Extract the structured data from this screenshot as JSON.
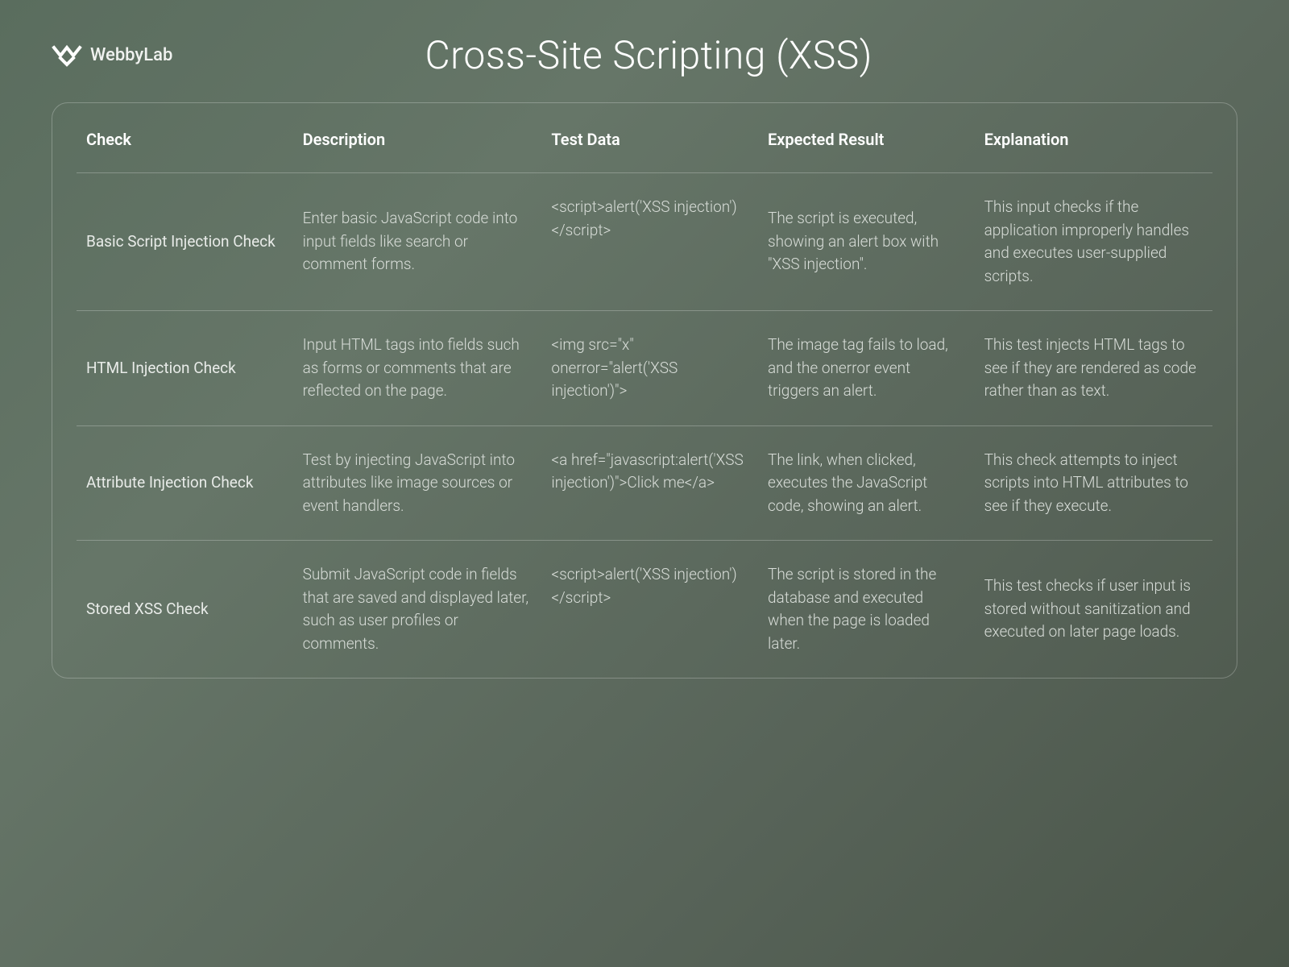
{
  "brand": "WebbyLab",
  "title": "Cross-Site Scripting (XSS)",
  "columns": [
    "Check",
    "Description",
    "Test Data",
    "Expected Result",
    "Explanation"
  ],
  "rows": [
    {
      "check": "Basic Script Injection Check",
      "description": "Enter basic JavaScript code into input fields like search or comment forms.",
      "testdata": "<script>alert('XSS injection')</script>",
      "expected": "The script is executed, showing an alert box with \"XSS injection\".",
      "explanation": "This input checks if the application improperly handles and executes user-supplied scripts."
    },
    {
      "check": "HTML Injection Check",
      "description": "Input HTML tags into fields such as forms or comments that are reflected on the page.",
      "testdata": "<img src=\"x\" onerror=\"alert('XSS injection')\">",
      "expected": "The image tag fails to load, and the onerror event triggers an alert.",
      "explanation": "This test injects HTML tags to see if they are rendered as code rather than as text."
    },
    {
      "check": "Attribute Injection Check",
      "description": "Test by injecting JavaScript into attributes like image sources or event handlers.",
      "testdata": "<a href=\"javascript:alert('XSS injection')\">Click me</a>",
      "expected": "The link, when clicked, executes the JavaScript code, showing an alert.",
      "explanation": "This check attempts to inject scripts into HTML attributes to see if they execute."
    },
    {
      "check": "Stored XSS Check",
      "description": "Submit JavaScript code in fields that are saved and displayed later, such as user profiles or comments.",
      "testdata": "<script>alert('XSS injection')</script>",
      "expected": "The script is stored in the database and executed when the page is loaded later.",
      "explanation": "This test checks if user input is stored without sanitization and executed on later page loads."
    }
  ]
}
